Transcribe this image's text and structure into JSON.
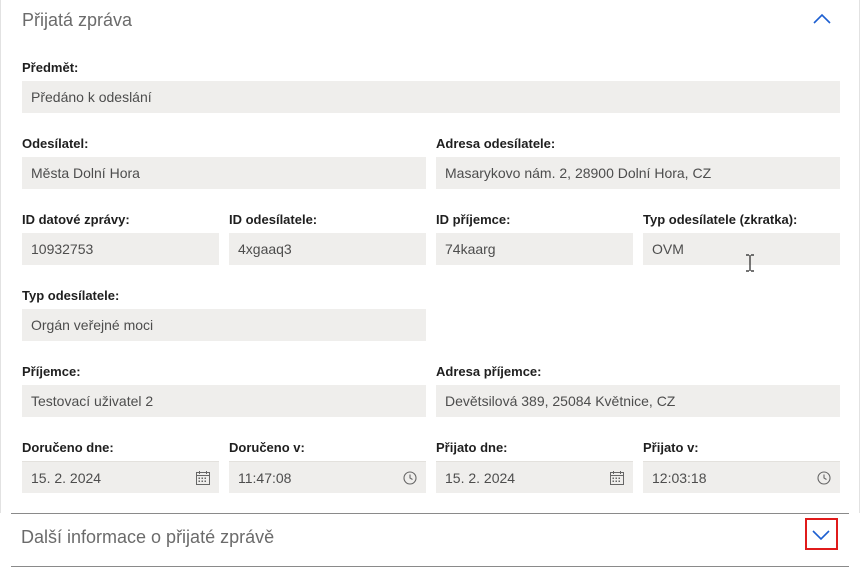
{
  "received_section": {
    "title": "Přijatá zpráva",
    "collapse_icon": "chevron-up-icon"
  },
  "fields": {
    "subject": {
      "label": "Předmět:",
      "value": "Předáno k odeslání"
    },
    "sender": {
      "label": "Odesílatel:",
      "value": "Města Dolní Hora"
    },
    "sender_address": {
      "label": "Adresa odesílatele:",
      "value": "Masarykovo nám. 2, 28900 Dolní Hora, CZ"
    },
    "message_id": {
      "label": "ID datové zprávy:",
      "value": "10932753"
    },
    "sender_id": {
      "label": "ID odesílatele:",
      "value": "4xgaaq3"
    },
    "recipient_id": {
      "label": "ID příjemce:",
      "value": "74kaarg"
    },
    "sender_type_short": {
      "label": "Typ odesílatele (zkratka):",
      "value": "OVM"
    },
    "sender_type": {
      "label": "Typ odesílatele:",
      "value": "Orgán veřejné moci"
    },
    "recipient": {
      "label": "Příjemce:",
      "value": "Testovací uživatel 2"
    },
    "recipient_address": {
      "label": "Adresa příjemce:",
      "value": "Devětsilová 389, 25084 Květnice, CZ"
    },
    "delivered_date": {
      "label": "Doručeno dne:",
      "value": "15. 2. 2024",
      "icon": "calendar-icon"
    },
    "delivered_time": {
      "label": "Doručeno v:",
      "value": "11:47:08",
      "icon": "clock-icon"
    },
    "accepted_date": {
      "label": "Přijato dne:",
      "value": "15. 2. 2024",
      "icon": "calendar-icon"
    },
    "accepted_time": {
      "label": "Přijato v:",
      "value": "12:03:18",
      "icon": "clock-icon"
    }
  },
  "more_section": {
    "title": "Další informace o přijaté zprávě",
    "expand_icon": "chevron-down-icon"
  },
  "colors": {
    "field_bg": "#efeeec",
    "chevron": "#1d5fd1",
    "focus_outline": "#e01b1b"
  }
}
